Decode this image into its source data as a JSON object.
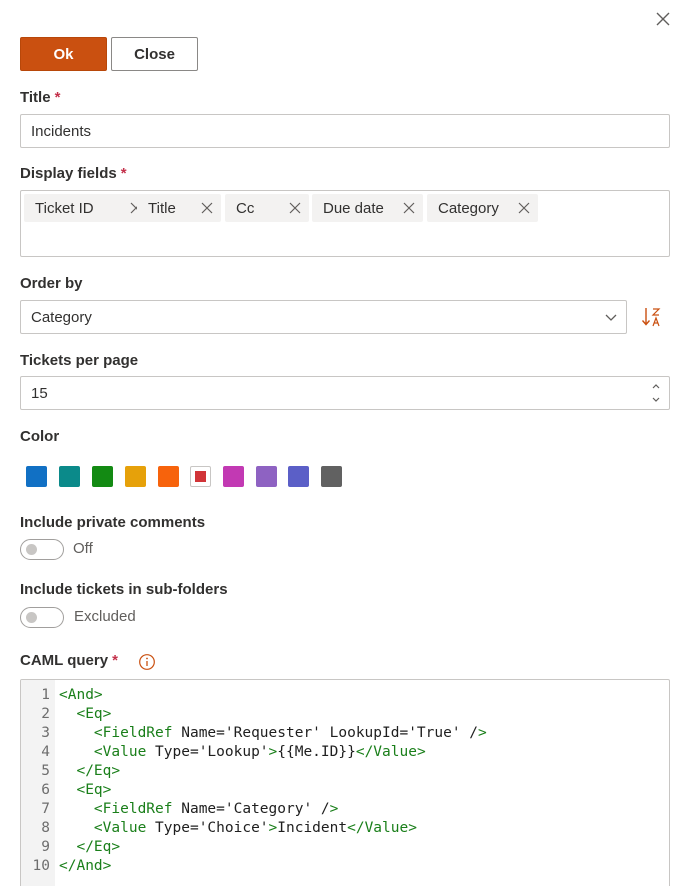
{
  "buttons": {
    "ok": "Ok",
    "close": "Close"
  },
  "title_field": {
    "label": "Title",
    "required_mark": "*",
    "value": "Incidents"
  },
  "display_fields": {
    "label": "Display fields",
    "required_mark": "*",
    "chips": [
      "Ticket ID",
      "Title",
      "Cc",
      "Due date",
      "Category"
    ]
  },
  "order_by": {
    "label": "Order by",
    "value": "Category"
  },
  "tickets_per_page": {
    "label": "Tickets per page",
    "value": "15"
  },
  "color": {
    "label": "Color",
    "swatches": [
      "#1170c4",
      "#0b8a8a",
      "#138a13",
      "#e6a10a",
      "#f7630c",
      "#d13438",
      "#c239b3",
      "#8e62c2",
      "#5b5fc7",
      "#616161"
    ],
    "selected_index": 5
  },
  "private_comments": {
    "label": "Include private comments",
    "state": "Off"
  },
  "sub_folders": {
    "label": "Include tickets in sub-folders",
    "state": "Excluded"
  },
  "caml_query": {
    "label": "CAML query",
    "required_mark": "*",
    "lines": [
      {
        "num": "1",
        "text": "<And>"
      },
      {
        "num": "2",
        "text": "  <Eq>"
      },
      {
        "num": "3",
        "text": "    <FieldRef Name='Requester' LookupId='True' />"
      },
      {
        "num": "4",
        "text": "    <Value Type='Lookup'>{{Me.ID}}</Value>"
      },
      {
        "num": "5",
        "text": "  </Eq>"
      },
      {
        "num": "6",
        "text": "  <Eq>"
      },
      {
        "num": "7",
        "text": "    <FieldRef Name='Category' />"
      },
      {
        "num": "8",
        "text": "    <Value Type='Choice'>Incident</Value>"
      },
      {
        "num": "9",
        "text": "  </Eq>"
      },
      {
        "num": "10",
        "text": "</And>"
      }
    ]
  }
}
